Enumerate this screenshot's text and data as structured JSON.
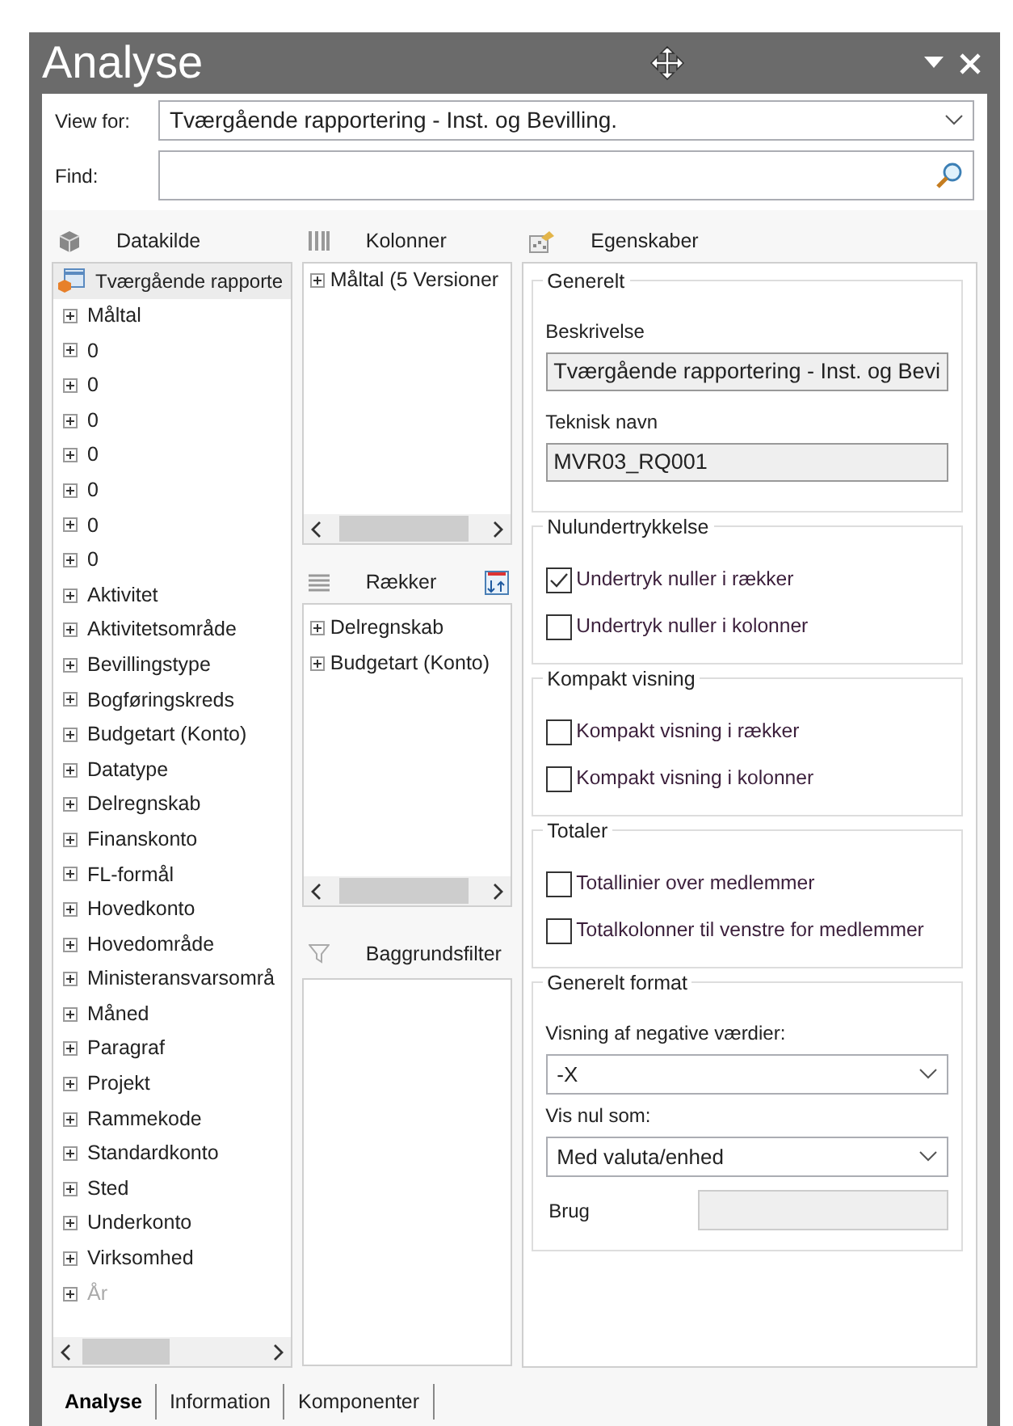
{
  "window": {
    "title": "Analyse"
  },
  "view_for": {
    "label": "View for:",
    "value": "Tværgående rapportering - Inst. og Bevilling."
  },
  "find": {
    "label": "Find:"
  },
  "datakilde": {
    "title": "Datakilde",
    "items": [
      {
        "kind": "root",
        "label": "Tværgående rapporte",
        "selected": true,
        "disabled": false
      },
      {
        "kind": "node",
        "label": "Måltal",
        "selected": false,
        "disabled": false
      },
      {
        "kind": "node",
        "label": "0",
        "selected": false,
        "disabled": false
      },
      {
        "kind": "node",
        "label": "0",
        "selected": false,
        "disabled": false
      },
      {
        "kind": "node",
        "label": "0",
        "selected": false,
        "disabled": false
      },
      {
        "kind": "node",
        "label": "0",
        "selected": false,
        "disabled": false
      },
      {
        "kind": "node",
        "label": "0",
        "selected": false,
        "disabled": false
      },
      {
        "kind": "node",
        "label": "0",
        "selected": false,
        "disabled": false
      },
      {
        "kind": "node",
        "label": "0",
        "selected": false,
        "disabled": false
      },
      {
        "kind": "node",
        "label": "Aktivitet",
        "selected": false,
        "disabled": false
      },
      {
        "kind": "node",
        "label": "Aktivitetsområde",
        "selected": false,
        "disabled": false
      },
      {
        "kind": "node",
        "label": "Bevillingstype",
        "selected": false,
        "disabled": false
      },
      {
        "kind": "node",
        "label": "Bogføringskreds",
        "selected": false,
        "disabled": false
      },
      {
        "kind": "node",
        "label": "Budgetart (Konto)",
        "selected": false,
        "disabled": false
      },
      {
        "kind": "node",
        "label": "Datatype",
        "selected": false,
        "disabled": false
      },
      {
        "kind": "node",
        "label": "Delregnskab",
        "selected": false,
        "disabled": false
      },
      {
        "kind": "node",
        "label": "Finanskonto",
        "selected": false,
        "disabled": false
      },
      {
        "kind": "node",
        "label": "FL-formål",
        "selected": false,
        "disabled": false
      },
      {
        "kind": "node",
        "label": "Hovedkonto",
        "selected": false,
        "disabled": false
      },
      {
        "kind": "node",
        "label": "Hovedområde",
        "selected": false,
        "disabled": false
      },
      {
        "kind": "node",
        "label": "Ministeransvarsområ",
        "selected": false,
        "disabled": false
      },
      {
        "kind": "node",
        "label": "Måned",
        "selected": false,
        "disabled": false
      },
      {
        "kind": "node",
        "label": "Paragraf",
        "selected": false,
        "disabled": false
      },
      {
        "kind": "node",
        "label": "Projekt",
        "selected": false,
        "disabled": false
      },
      {
        "kind": "node",
        "label": "Rammekode",
        "selected": false,
        "disabled": false
      },
      {
        "kind": "node",
        "label": "Standardkonto",
        "selected": false,
        "disabled": false
      },
      {
        "kind": "node",
        "label": "Sted",
        "selected": false,
        "disabled": false
      },
      {
        "kind": "node",
        "label": "Underkonto",
        "selected": false,
        "disabled": false
      },
      {
        "kind": "node",
        "label": "Virksomhed",
        "selected": false,
        "disabled": false
      },
      {
        "kind": "node",
        "label": "År",
        "selected": false,
        "disabled": true
      }
    ]
  },
  "kolonner": {
    "title": "Kolonner",
    "items": [
      "Måltal (5 Versioner"
    ]
  },
  "raekker": {
    "title": "Rækker",
    "items": [
      "Delregnskab",
      "Budgetart (Konto)"
    ]
  },
  "baggrundsfilter": {
    "title": "Baggrundsfilter"
  },
  "egenskaber": {
    "title": "Egenskaber",
    "groups": [
      {
        "title": "Generelt",
        "fields": [
          {
            "kind": "text",
            "label": "Beskrivelse",
            "value": "Tværgående rapportering - Inst. og Bevi"
          },
          {
            "kind": "text",
            "label": "Teknisk navn",
            "value": "MVR03_RQ001"
          }
        ]
      },
      {
        "title": "Nulundertrykkelse",
        "fields": [
          {
            "kind": "checkbox",
            "label": "Undertryk nuller i rækker",
            "checked": true
          },
          {
            "kind": "checkbox",
            "label": "Undertryk nuller i kolonner",
            "checked": false
          }
        ]
      },
      {
        "title": "Kompakt visning",
        "fields": [
          {
            "kind": "checkbox",
            "label": "Kompakt visning i rækker",
            "checked": false
          },
          {
            "kind": "checkbox",
            "label": "Kompakt visning i kolonner",
            "checked": false
          }
        ]
      },
      {
        "title": "Totaler",
        "fields": [
          {
            "kind": "checkbox",
            "label": "Totallinier over medlemmer",
            "checked": false
          },
          {
            "kind": "checkbox",
            "label": "Totalkolonner til venstre for medlemmer",
            "checked": false
          }
        ]
      },
      {
        "title": "Generelt format",
        "fields": [
          {
            "kind": "select",
            "label": "Visning af negative værdier:",
            "value": "-X"
          },
          {
            "kind": "select",
            "label": "Vis nul som:",
            "value": "Med valuta/enhed"
          },
          {
            "kind": "inline",
            "label": "Brug"
          }
        ]
      }
    ]
  },
  "tabs": [
    {
      "label": "Analyse",
      "selected": true
    },
    {
      "label": "Information",
      "selected": false
    },
    {
      "label": "Komponenter",
      "selected": false
    }
  ]
}
